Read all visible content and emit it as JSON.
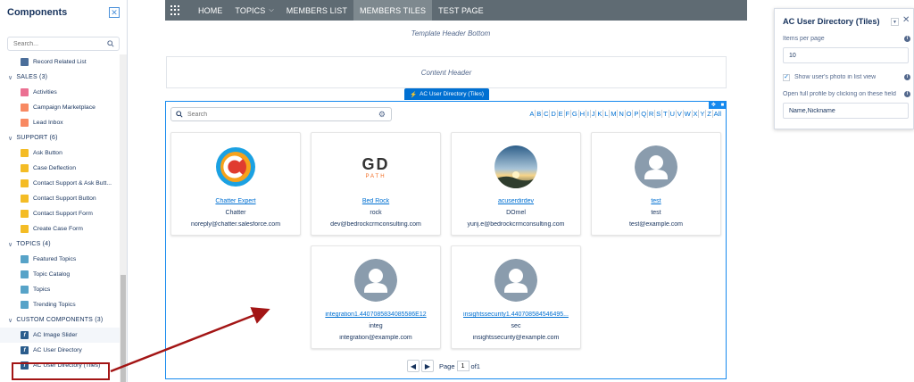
{
  "left_panel": {
    "title": "Components",
    "search_placeholder": "Search...",
    "items": [
      {
        "type": "item",
        "label": "Record Related List",
        "icon": "list-icon",
        "color": "#4b6e9a"
      },
      {
        "type": "section",
        "label": "SALES (3)"
      },
      {
        "type": "item",
        "label": "Activities",
        "icon": "activity-icon",
        "color": "#eb7092"
      },
      {
        "type": "item",
        "label": "Campaign Marketplace",
        "icon": "campaign-icon",
        "color": "#f88962"
      },
      {
        "type": "item",
        "label": "Lead Inbox",
        "icon": "lead-icon",
        "color": "#f88962"
      },
      {
        "type": "section",
        "label": "SUPPORT (6)"
      },
      {
        "type": "item",
        "label": "Ask Button",
        "icon": "ask-icon",
        "color": "#f4bc25"
      },
      {
        "type": "item",
        "label": "Case Deflection",
        "icon": "deflection-icon",
        "color": "#f4bc25"
      },
      {
        "type": "item",
        "label": "Contact Support & Ask Butt...",
        "icon": "contact-icon",
        "color": "#f4bc25"
      },
      {
        "type": "item",
        "label": "Contact Support Button",
        "icon": "contact-icon",
        "color": "#f4bc25"
      },
      {
        "type": "item",
        "label": "Contact Support Form",
        "icon": "form-icon",
        "color": "#f4bc25"
      },
      {
        "type": "item",
        "label": "Create Case Form",
        "icon": "case-icon",
        "color": "#f4bc25"
      },
      {
        "type": "section",
        "label": "TOPICS (4)"
      },
      {
        "type": "item",
        "label": "Featured Topics",
        "icon": "topics-icon",
        "color": "#57a3c8"
      },
      {
        "type": "item",
        "label": "Topic Catalog",
        "icon": "catalog-icon",
        "color": "#57a3c8"
      },
      {
        "type": "item",
        "label": "Topics",
        "icon": "topic-icon",
        "color": "#57a3c8"
      },
      {
        "type": "item",
        "label": "Trending Topics",
        "icon": "trending-icon",
        "color": "#57a3c8"
      },
      {
        "type": "section",
        "label": "CUSTOM COMPONENTS (3)"
      },
      {
        "type": "item",
        "label": "AC Image Slider",
        "icon": "lightning-icon",
        "color": "#2a5c8c",
        "selected": true
      },
      {
        "type": "item",
        "label": "AC User Directory",
        "icon": "lightning-icon",
        "color": "#2a5c8c"
      },
      {
        "type": "item",
        "label": "AC User Directory (Tiles)",
        "icon": "lightning-icon",
        "color": "#2a5c8c"
      }
    ]
  },
  "nav": {
    "items": [
      "HOME",
      "TOPICS",
      "MEMBERS LIST",
      "MEMBERS TILES",
      "TEST PAGE"
    ],
    "active": "MEMBERS TILES"
  },
  "canvas": {
    "template_header": "Template Header Bottom",
    "content_header": "Content Header",
    "component_tab": "AC User Directory (Tiles)"
  },
  "directory": {
    "search_placeholder": "Search",
    "alphabet": [
      "A",
      "B",
      "C",
      "D",
      "E",
      "F",
      "G",
      "H",
      "I",
      "J",
      "K",
      "L",
      "M",
      "N",
      "O",
      "P",
      "Q",
      "R",
      "S",
      "T",
      "U",
      "V",
      "W",
      "X",
      "Y",
      "Z",
      "All"
    ],
    "users": [
      {
        "name": "Chatter Expert",
        "nickname": "Chatter",
        "email": "noreply@chatter.salesforce.com",
        "avatar": "chatter-logo"
      },
      {
        "name": "Bed Rock",
        "nickname": "rock",
        "email": "dev@bedrockcrmconsulting.com",
        "avatar": "gd-path-logo"
      },
      {
        "name": "acuserdirdev",
        "nickname": "DOmel",
        "email": "yurij.e@bedrockcrmconsulting.com",
        "avatar": "sunrise-photo"
      },
      {
        "name": "test",
        "nickname": "test",
        "email": "test@example.com",
        "avatar": "default-avatar"
      },
      {
        "name": "integration1.4407085834085586E12",
        "nickname": "integ",
        "email": "integration@example.com",
        "avatar": "default-avatar"
      },
      {
        "name": "insightssecurity1.440708584546495...",
        "nickname": "sec",
        "email": "insightssecurity@example.com",
        "avatar": "default-avatar"
      }
    ],
    "logo_gd": "GD",
    "logo_path": "PATH",
    "pager": {
      "label": "Page",
      "current": "1",
      "total_label": "of1"
    }
  },
  "right_panel": {
    "title": "AC User Directory (Tiles)",
    "items_label": "Items per page",
    "items_value": "10",
    "photo_label": "Show user's photo in list view",
    "profile_label": "Open full profile by clicking on these field",
    "profile_value": "Name,Nickname"
  },
  "colors": {
    "accent": "#0070d2",
    "nav_bg": "#5f6b73",
    "highlight": "#a31515"
  }
}
